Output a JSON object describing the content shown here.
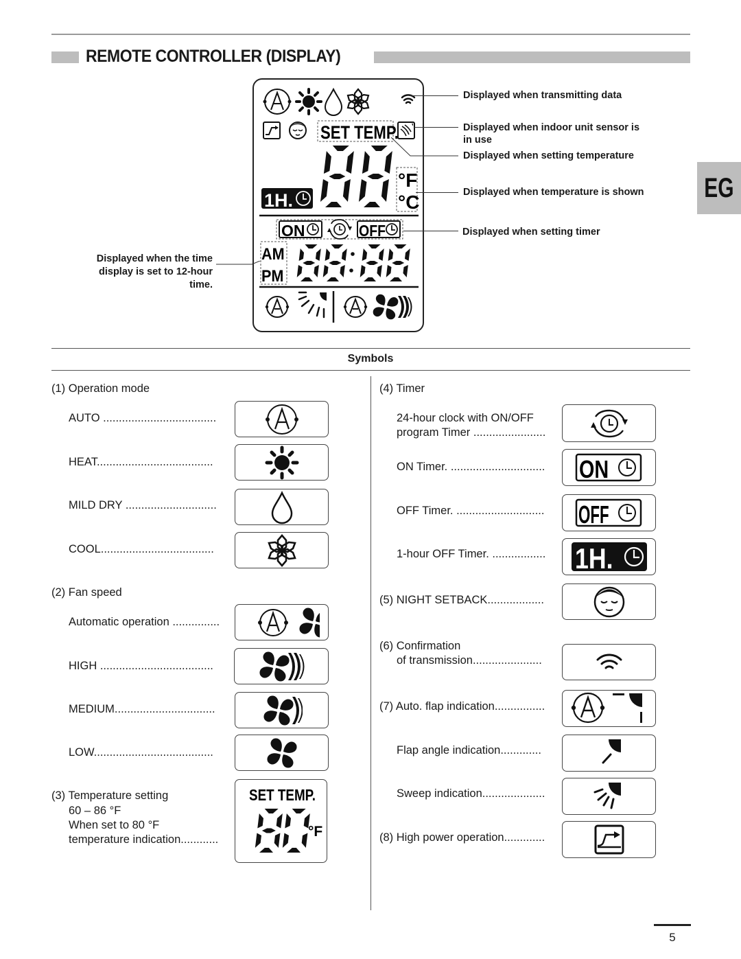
{
  "header": {
    "title": "REMOTE CONTROLLER (DISPLAY)",
    "side_tab": "EG"
  },
  "display_panel": {
    "set_temp_label": "SET TEMP.",
    "temp_digits": "88",
    "unit_f": "°F",
    "unit_c": "°C",
    "one_hour_label": "1H.",
    "on_label": "ON",
    "off_label": "OFF",
    "am_label": "AM",
    "pm_label": "PM",
    "clock_digits": "88·88",
    "callouts": {
      "transmitting": "Displayed when transmitting data",
      "sensor_line1": "Displayed when indoor unit sensor is",
      "sensor_line2": "in use",
      "setting_temp": "Displayed when setting temperature",
      "temp_shown": "Displayed when temperature is shown",
      "setting_timer": "Displayed when setting timer",
      "time12_line1": "Displayed when the time",
      "time12_line2": "display is set to 12-hour",
      "time12_line3": "time."
    }
  },
  "symbols": {
    "title": "Symbols",
    "left": {
      "operation_mode": {
        "heading": "(1) Operation mode",
        "items": [
          {
            "label": "AUTO ....................................",
            "icon": "auto-mode-icon"
          },
          {
            "label": "HEAT.....................................",
            "icon": "sun-icon"
          },
          {
            "label": "MILD DRY .............................",
            "icon": "droplet-icon"
          },
          {
            "label": "COOL....................................",
            "icon": "snowflake-icon"
          }
        ]
      },
      "fan_speed": {
        "heading": "(2) Fan speed",
        "items": [
          {
            "label": "Automatic operation ...............",
            "icon": "auto-fan-icon"
          },
          {
            "label": "HIGH ....................................",
            "icon": "fan-high-icon"
          },
          {
            "label": "MEDIUM................................",
            "icon": "fan-medium-icon"
          },
          {
            "label": "LOW......................................",
            "icon": "fan-low-icon"
          }
        ]
      },
      "temperature": {
        "heading": "(3) Temperature setting",
        "line2": "60 – 86 °F",
        "line3": "When set to 80 °F",
        "line4": "temperature indication............",
        "set_temp_label": "SET TEMP.",
        "value": "80",
        "unit": "°F"
      }
    },
    "right": {
      "timer": {
        "heading": "(4) Timer",
        "items": [
          {
            "label_line1": "24-hour clock with ON/OFF",
            "label_line2": "program Timer .......................",
            "icon": "program-timer-icon"
          },
          {
            "label_line1": "ON Timer. ..............................",
            "icon": "on-timer-icon",
            "badge": "ON"
          },
          {
            "label_line1": "OFF Timer. ............................",
            "icon": "off-timer-icon",
            "badge": "OFF"
          },
          {
            "label_line1": "1-hour OFF Timer. .................",
            "icon": "one-hour-timer-icon",
            "badge": "1H."
          }
        ]
      },
      "night_setback": {
        "label": "(5) NIGHT SETBACK..................",
        "icon": "sleeping-face-icon"
      },
      "transmission": {
        "line1": "(6) Confirmation",
        "line2": "of transmission......................",
        "icon": "signal-icon"
      },
      "flap": {
        "items": [
          {
            "label": "(7) Auto. flap indication................",
            "icon": "auto-flap-icon"
          },
          {
            "label": "Flap angle indication.............",
            "icon": "flap-angle-icon"
          },
          {
            "label": "Sweep indication....................",
            "icon": "sweep-icon"
          }
        ]
      },
      "high_power": {
        "label": "(8) High power operation.............",
        "icon": "high-power-icon"
      }
    }
  },
  "footer": {
    "page_number": "5"
  }
}
